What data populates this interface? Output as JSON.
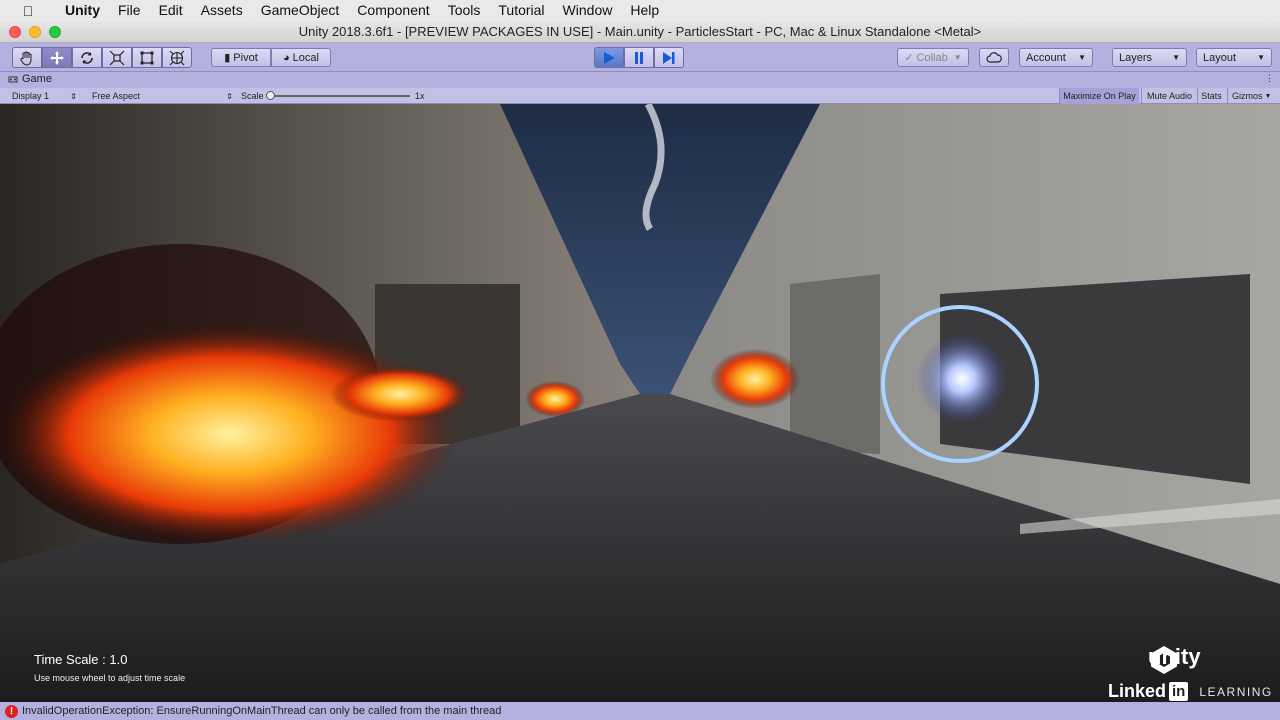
{
  "menubar": {
    "items": [
      "Unity",
      "File",
      "Edit",
      "Assets",
      "GameObject",
      "Component",
      "Tools",
      "Tutorial",
      "Window",
      "Help"
    ]
  },
  "window": {
    "title": "Unity 2018.3.6f1 - [PREVIEW PACKAGES IN USE] - Main.unity - ParticlesStart - PC, Mac & Linux Standalone <Metal>"
  },
  "toolbar": {
    "tools": [
      "hand-tool",
      "move-tool",
      "rotate-tool",
      "scale-tool",
      "rect-tool",
      "transform-tool"
    ],
    "active_tool": "move-tool",
    "pivot_label": "Pivot",
    "local_label": "Local",
    "collab_label": "Collab",
    "account_label": "Account",
    "layers_label": "Layers",
    "layout_label": "Layout"
  },
  "game_view": {
    "tab_label": "Game",
    "display_label": "Display 1",
    "aspect_label": "Free Aspect",
    "scale_label": "Scale",
    "scale_value": "1x",
    "maximize_label": "Maximize On Play",
    "mute_label": "Mute Audio",
    "stats_label": "Stats",
    "gizmos_label": "Gizmos"
  },
  "hud": {
    "time_scale": "Time Scale : 1.0",
    "hint": "Use mouse wheel to adjust time scale"
  },
  "branding": {
    "unity": "unity",
    "linkedin": "Linked",
    "in": "in",
    "learning": "LEARNING"
  },
  "status": {
    "message": "InvalidOperationException: EnsureRunningOnMainThread can only be called from the main thread"
  },
  "colors": {
    "play_tint": "#b4b0df",
    "play_button": "#5a78c8",
    "error": "#dd2222"
  }
}
